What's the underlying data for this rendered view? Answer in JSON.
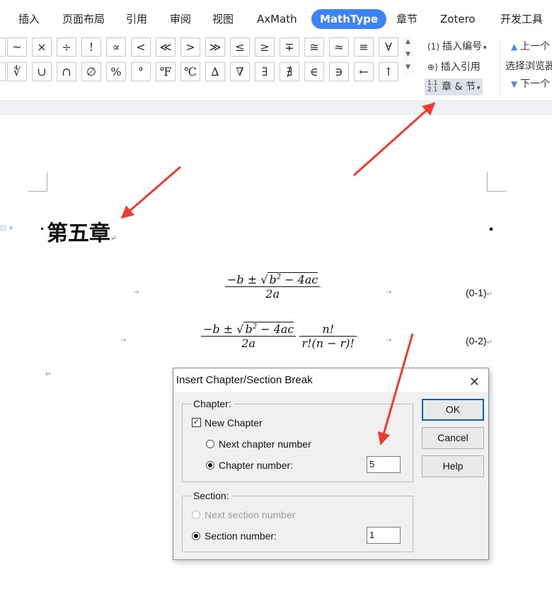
{
  "tabs": [
    "插入",
    "页面布局",
    "引用",
    "审阅",
    "视图",
    "AxMath",
    "MathType",
    "章节",
    "Zotero",
    "开发工具"
  ],
  "active_tab": "MathType",
  "symbols_row1": [
    "~",
    "×",
    "÷",
    "!",
    "∝",
    "<",
    "≪",
    ">",
    "≫",
    "≤",
    "≥",
    "∓",
    "≅",
    "≈",
    "≡",
    "∀"
  ],
  "symbols_row2": [
    "∜",
    "∪",
    "∩",
    "∅",
    "%",
    "°",
    "℉",
    "℃",
    "∆",
    "∇",
    "∃",
    "∄",
    "∈",
    "∋",
    "←",
    "↑"
  ],
  "ribbon": {
    "insert_number": "插入编号",
    "insert_number_icon": "(1)",
    "insert_ref": "插入引用",
    "chapter_section": "章 & 节",
    "chapter_section_icon": "1.1 2.1",
    "prev": "上一个",
    "browse": "选择浏览器",
    "next": "下一个"
  },
  "document": {
    "chapter_title": "第五章",
    "eq1_number": "(0-1)",
    "eq2_number": "(0-2)"
  },
  "dialog": {
    "title": "Insert Chapter/Section Break",
    "chapter_group": "Chapter:",
    "new_chapter": "New Chapter",
    "new_chapter_checked": true,
    "next_chapter": "Next chapter number",
    "chapter_number_label": "Chapter number:",
    "chapter_number_value": "5",
    "section_group": "Section:",
    "next_section": "Next section number",
    "section_number_label": "Section number:",
    "section_number_value": "1",
    "ok": "OK",
    "cancel": "Cancel",
    "help": "Help"
  },
  "colors": {
    "active_tab_bg": "#3e82f7",
    "arrow": "#f03a2e",
    "default_button_border": "#0f5fb8"
  }
}
